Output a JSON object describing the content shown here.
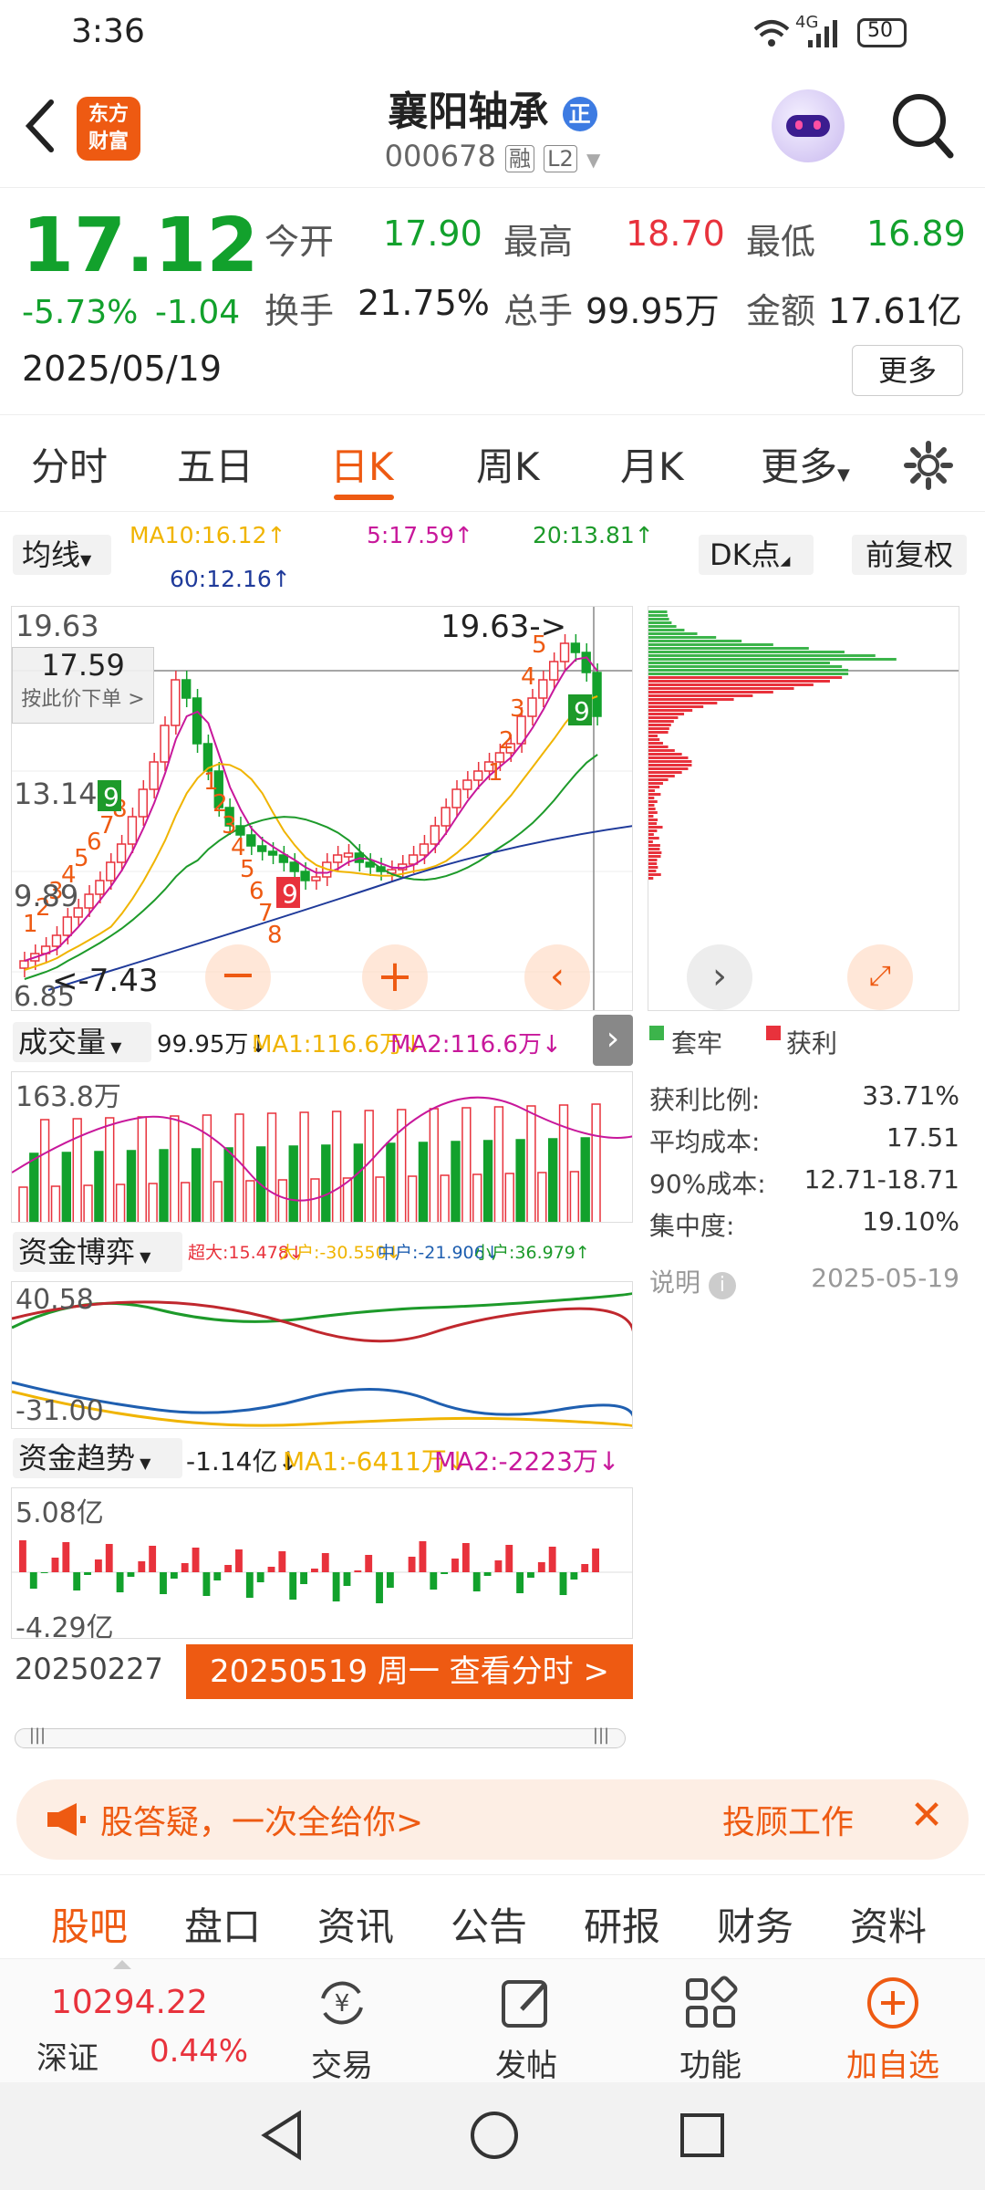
{
  "status_bar": {
    "time": "3:36",
    "network": "4G",
    "battery": "50"
  },
  "header": {
    "stock_name": "襄阳轴承",
    "badge": "正",
    "code": "000678",
    "tag_margin": "融",
    "tag_level": "L2",
    "logo_line1": "东方",
    "logo_line2": "财富"
  },
  "quote": {
    "price": "17.12",
    "change_pct": "-5.73%",
    "change": "-1.04",
    "date": "2025/05/19",
    "open_label": "今开",
    "open": "17.90",
    "high_label": "最高",
    "high": "18.70",
    "low_label": "最低",
    "low": "16.89",
    "turnover_label": "换手",
    "turnover": "21.75%",
    "volume_label": "总手",
    "volume": "99.95万",
    "amount_label": "金额",
    "amount": "17.61亿",
    "more": "更多"
  },
  "tabs": {
    "t1": "分时",
    "t2": "五日",
    "t3": "日K",
    "t4": "周K",
    "t5": "月K",
    "t6": "更多"
  },
  "ma_bar": {
    "selector": "均线",
    "ma10": "MA10:16.12↑",
    "ma5": "5:17.59↑",
    "ma20": "20:13.81↑",
    "ma60": "60:12.16↑",
    "dk": "DK点",
    "fq": "前复权"
  },
  "kchart": {
    "y_top": "19.63",
    "y_mid": "13.14",
    "y_low1": "9.89",
    "y_bot": "6.85",
    "cross_price": "17.59",
    "cross_hint": "按此价下单 >",
    "high_mark": "19.63->",
    "low_mark": "<-7.43",
    "badge9a": "9",
    "badge9b": "9",
    "badge9c": "9",
    "seq_up": [
      "1",
      "2",
      "3",
      "4",
      "5",
      "6",
      "7",
      "8"
    ],
    "seq_dn": [
      "1",
      "2",
      "3",
      "4",
      "5",
      "6",
      "7",
      "8"
    ]
  },
  "chip": {
    "legend_trap": "套牢",
    "legend_profit": "获利",
    "profit_ratio_label": "获利比例:",
    "profit_ratio": "33.71%",
    "avg_cost_label": "平均成本:",
    "avg_cost": "17.51",
    "cost90_label": "90%成本:",
    "cost90": "12.71-18.71",
    "concentration_label": "集中度:",
    "concentration": "19.10%",
    "note_label": "说明",
    "note_date": "2025-05-19"
  },
  "volume_panel": {
    "selector": "成交量",
    "vol": "99.95万↓",
    "ma1": "MA1:116.6万↓",
    "ma2": "MA2:116.6万↓",
    "y_top": "163.8万"
  },
  "fund_game": {
    "selector": "资金博弈",
    "super": "超大:15.478↓",
    "large": "大户:-30.550↓",
    "mid": "中户:-21.906↓",
    "small": "小户:36.979↑",
    "y_top": "40.58",
    "y_bot": "-31.00"
  },
  "fund_trend": {
    "selector": "资金趋势",
    "value": "-1.14亿↓",
    "ma1": "MA1:-6411万↓",
    "ma2": "MA2:-2223万↓",
    "y_top": "5.08亿",
    "y_bot": "-4.29亿"
  },
  "timeline": {
    "start_date": "20250227",
    "cta": "20250519 周一 查看分时 >"
  },
  "banner": {
    "text": "股答疑，一次全给你>",
    "right": "投顾工作"
  },
  "bottom_tabs": {
    "b1": "股吧",
    "b2": "盘口",
    "b3": "资讯",
    "b4": "公告",
    "b5": "研报",
    "b6": "财务",
    "b7": "资料"
  },
  "dock": {
    "index_value": "10294.22",
    "index_name": "深证",
    "index_change": "0.44%",
    "trade": "交易",
    "post": "发帖",
    "func": "功能",
    "add": "加自选"
  },
  "colors": {
    "up": "#e8323c",
    "down": "#12a12c",
    "accent": "#ee5a12",
    "ma5": "#c8189b",
    "ma10": "#f0b400",
    "ma20": "#1d9a2a",
    "ma60": "#1f3a9a"
  }
}
